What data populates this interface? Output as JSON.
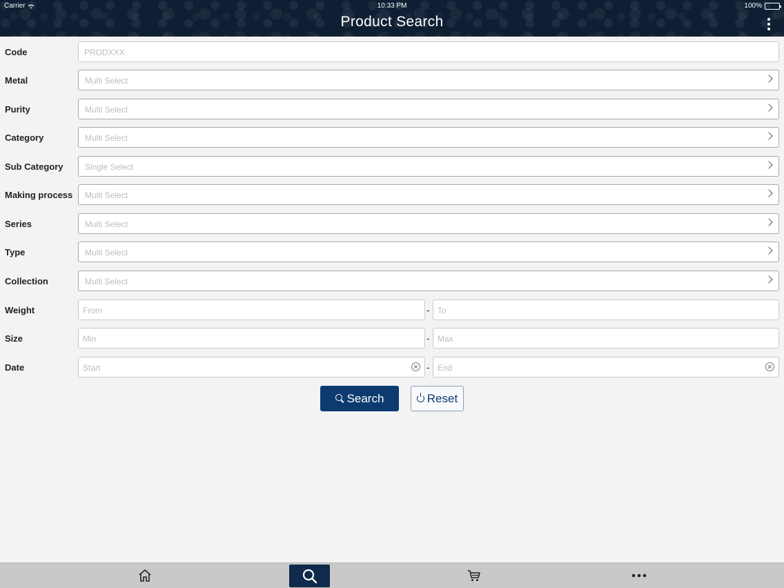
{
  "status_bar": {
    "carrier": "Carrier",
    "time": "10:33 PM",
    "battery": "100%"
  },
  "header": {
    "title": "Product Search",
    "menu_icon": "more-vertical-icon"
  },
  "form": {
    "code": {
      "label": "Code",
      "placeholder": "PRODXXX"
    },
    "metal": {
      "label": "Metal",
      "placeholder": "Multi Select"
    },
    "purity": {
      "label": "Purity",
      "placeholder": "Multi Select"
    },
    "category": {
      "label": "Category",
      "placeholder": "Multi Select"
    },
    "sub_category": {
      "label": "Sub Category",
      "placeholder": "Single Select"
    },
    "making_process": {
      "label": "Making process",
      "placeholder": "Multi Select"
    },
    "series": {
      "label": "Series",
      "placeholder": "Multi Select"
    },
    "type": {
      "label": "Type",
      "placeholder": "Multi Select"
    },
    "collection": {
      "label": "Collection",
      "placeholder": "Multi Select"
    },
    "weight": {
      "label": "Weight",
      "from": "From",
      "to": "To"
    },
    "size": {
      "label": "Size",
      "min": "Min",
      "max": "Max"
    },
    "date": {
      "label": "Date",
      "start": "Start",
      "end": "End"
    },
    "separator": "-"
  },
  "buttons": {
    "search": "Search",
    "reset": "Reset"
  },
  "tabbar": {
    "items": [
      {
        "name": "home",
        "icon": "home-icon"
      },
      {
        "name": "search",
        "icon": "search-icon",
        "active": true
      },
      {
        "name": "cart",
        "icon": "cart-icon"
      },
      {
        "name": "more",
        "icon": "more-horizontal-icon"
      }
    ]
  },
  "colors": {
    "header_bg": "#0f1f33",
    "primary": "#0d3b70",
    "tabbar_bg": "#c9c9c9"
  }
}
